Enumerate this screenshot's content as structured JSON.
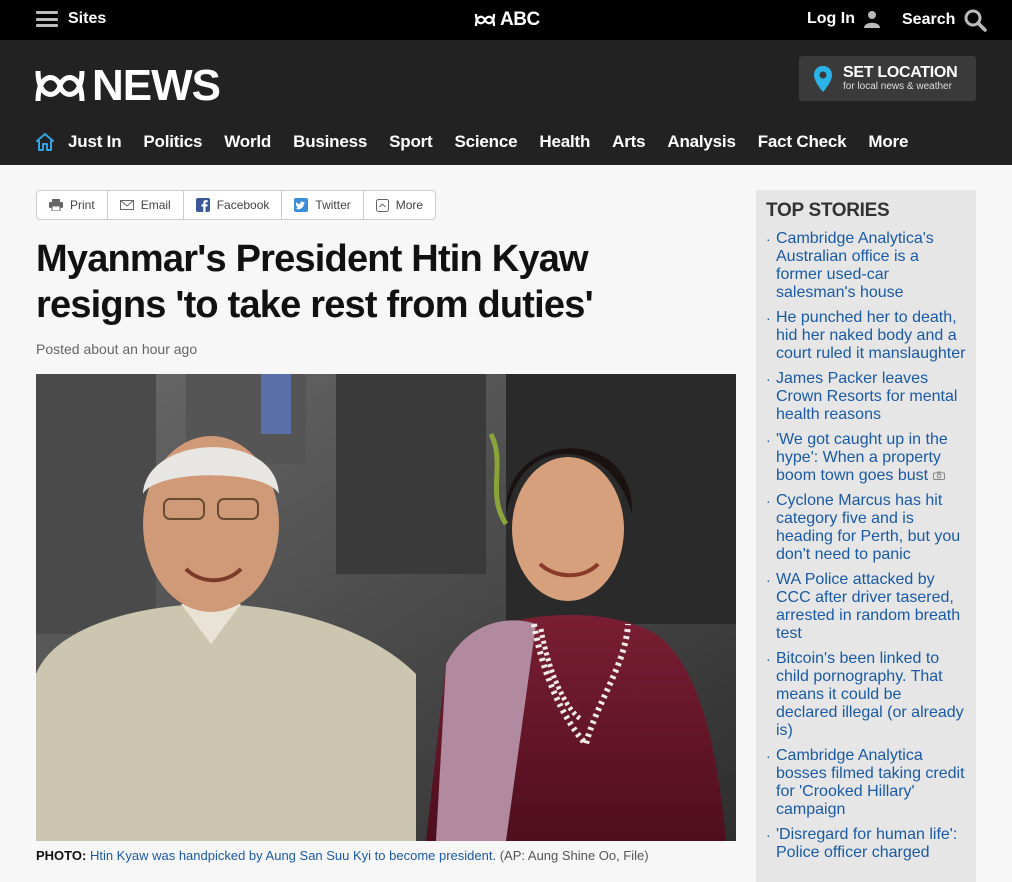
{
  "topbar": {
    "sites_label": "Sites",
    "abc_label": "ABC",
    "login_label": "Log In",
    "search_label": "Search"
  },
  "masthead": {
    "news_label": "NEWS",
    "set_location": {
      "title": "SET LOCATION",
      "subtitle": "for local news & weather"
    }
  },
  "nav": {
    "items": [
      "Just In",
      "Politics",
      "World",
      "Business",
      "Sport",
      "Science",
      "Health",
      "Arts",
      "Analysis",
      "Fact Check",
      "More"
    ]
  },
  "share": {
    "print": "Print",
    "email": "Email",
    "facebook": "Facebook",
    "twitter": "Twitter",
    "more": "More"
  },
  "article": {
    "headline": "Myanmar's President Htin Kyaw resigns 'to take rest from duties'",
    "posted": "Posted about an hour ago",
    "caption_label": "PHOTO:",
    "caption_text": "Htin Kyaw was handpicked by Aung San Suu Kyi to become president.",
    "caption_credit": "(AP: Aung Shine Oo, File)"
  },
  "sidebar": {
    "title": "TOP STORIES",
    "stories": [
      "Cambridge Analytica's Australian office is a former used-car salesman's house",
      "He punched her to death, hid her naked body and a court ruled it manslaughter",
      "James Packer leaves Crown Resorts for mental health reasons",
      "'We got caught up in the hype': When a property boom town goes bust",
      "Cyclone Marcus has hit category five and is heading for Perth, but you don't need to panic",
      "WA Police attacked by CCC after driver tasered, arrested in random breath test",
      "Bitcoin's been linked to child pornography. That means it could be declared illegal (or already is)",
      "Cambridge Analytica bosses filmed taking credit for 'Crooked Hillary' campaign",
      "'Disregard for human life': Police officer charged"
    ]
  },
  "colors": {
    "link_blue": "#1a5aa5",
    "nav_home_blue": "#33a5e5",
    "location_pin": "#2bb3e8"
  }
}
